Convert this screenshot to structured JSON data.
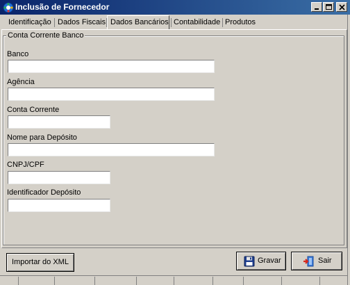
{
  "window": {
    "title": "Inclusão de Fornecedor"
  },
  "tabs": [
    {
      "label": "Identificação",
      "active": false
    },
    {
      "label": "Dados Fiscais",
      "active": false
    },
    {
      "label": "Dados Bancários",
      "active": true
    },
    {
      "label": "Contabilidade",
      "active": false
    },
    {
      "label": "Produtos",
      "active": false
    }
  ],
  "group": {
    "title": "Conta Corrente Banco"
  },
  "fields": [
    {
      "label": "Banco",
      "value": "",
      "placeholder": ""
    },
    {
      "label": "Agência",
      "value": "",
      "placeholder": ""
    },
    {
      "label": "Conta Corrente",
      "value": "",
      "placeholder": ""
    },
    {
      "label": "Nome para Depósito",
      "value": "",
      "placeholder": ""
    },
    {
      "label": "CNPJ/CPF",
      "value": "",
      "placeholder": ""
    },
    {
      "label": "Identificador Depósito",
      "value": "",
      "placeholder": ""
    }
  ],
  "buttons": {
    "importar": "Importar do XML",
    "gravar": "Gravar",
    "sair": "Sair"
  },
  "icons": {
    "app": "app-icon",
    "gravar": "floppy-disk-icon",
    "sair": "exit-door-icon"
  },
  "colors": {
    "titlebar_start": "#0a246a",
    "titlebar_end": "#3a6ea5",
    "window_bg": "#d4d0c8"
  }
}
